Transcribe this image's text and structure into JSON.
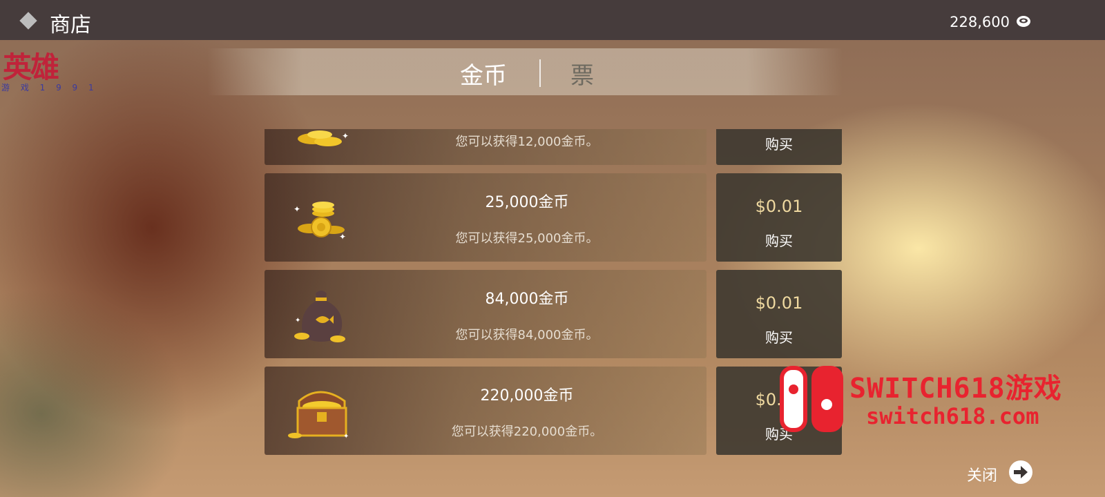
{
  "header": {
    "title": "商店",
    "balance": "228,600",
    "icon": "coin-icon"
  },
  "tabs": [
    {
      "label": "金币",
      "active": true
    },
    {
      "label": "票",
      "active": false
    }
  ],
  "watermark": {
    "logo": "英雄",
    "sub": "游 戏 1 9 9 1",
    "brand_line1": "SWITCH618游戏",
    "brand_line2": "switch618.com"
  },
  "items": [
    {
      "name": "",
      "desc": "您可以获得12,000金币。",
      "price": "",
      "buy_label": "购买",
      "icon": "coin-stack-icon"
    },
    {
      "name": "25,000金币",
      "desc": "您可以获得25,000金币。",
      "price": "$0.01",
      "buy_label": "购买",
      "icon": "coin-pile-icon"
    },
    {
      "name": "84,000金币",
      "desc": "您可以获得84,000金币。",
      "price": "$0.01",
      "buy_label": "购买",
      "icon": "coin-bag-icon"
    },
    {
      "name": "220,000金币",
      "desc": "您可以获得220,000金币。",
      "price": "$0.01",
      "buy_label": "购买",
      "icon": "treasure-chest-icon"
    }
  ],
  "close": {
    "label": "关闭",
    "icon": "arrow-right-icon"
  },
  "colors": {
    "topbar": "#463c3c",
    "price": "#efd9a0",
    "brand_red": "#e8232f"
  }
}
